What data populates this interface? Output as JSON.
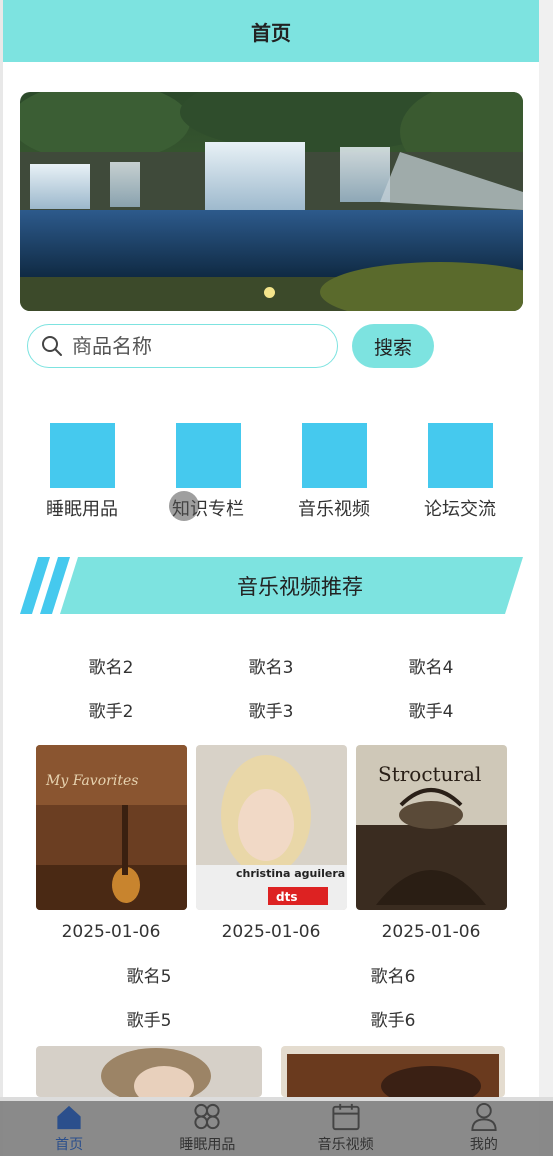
{
  "header": {
    "title": "首页"
  },
  "search": {
    "placeholder": "商品名称",
    "button_label": "搜索"
  },
  "categories": [
    {
      "label": "睡眠用品"
    },
    {
      "label": "知识专栏"
    },
    {
      "label": "音乐视频"
    },
    {
      "label": "论坛交流"
    }
  ],
  "section": {
    "title": "音乐视频推荐"
  },
  "songs": [
    {
      "name": "歌名2",
      "singer": "歌手2",
      "date": "2025-01-06"
    },
    {
      "name": "歌名3",
      "singer": "歌手3",
      "date": "2025-01-06"
    },
    {
      "name": "歌名4",
      "singer": "歌手4",
      "date": "2025-01-06"
    },
    {
      "name": "歌名5",
      "singer": "歌手5"
    },
    {
      "name": "歌名6",
      "singer": "歌手6"
    }
  ],
  "covers": {
    "cover1_text": "My Favorites",
    "cover2_text": "christina aguilera",
    "cover2_sub": "dts",
    "cover3_text": "Stroctural"
  },
  "tabbar": [
    {
      "label": "首页",
      "icon": "home-icon",
      "active": true
    },
    {
      "label": "睡眠用品",
      "icon": "grid-icon"
    },
    {
      "label": "音乐视频",
      "icon": "calendar-icon"
    },
    {
      "label": "我的",
      "icon": "user-icon"
    }
  ],
  "colors": {
    "accent": "#7de3e0",
    "category_icon": "#45c9ee",
    "active_tab": "#2b4f8c"
  }
}
